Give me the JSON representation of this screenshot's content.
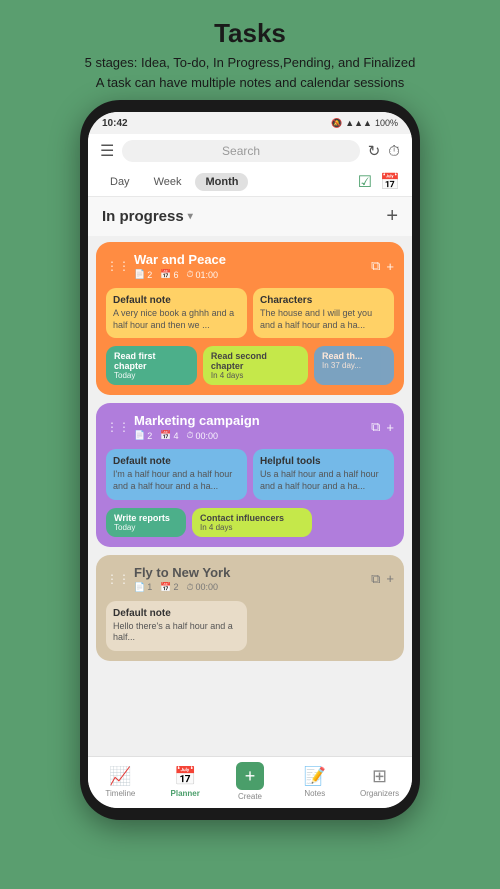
{
  "header": {
    "title": "Tasks",
    "subtitle_line1": "5 stages: Idea, To-do, In Progress,Pending, and Finalized",
    "subtitle_line2": "A task can have multiple notes and calendar sessions"
  },
  "status_bar": {
    "time": "10:42",
    "right_icons": "🔔 📶 🔋 100%"
  },
  "top_bar": {
    "search_placeholder": "Search",
    "refresh_icon": "↻",
    "timer_icon": "⏱"
  },
  "tabs": {
    "items": [
      "Day",
      "Week",
      "Month"
    ],
    "active": "Month"
  },
  "section": {
    "title": "In progress",
    "dropdown": "▾"
  },
  "tasks": [
    {
      "id": "war-peace",
      "title": "War and Peace",
      "meta": [
        {
          "icon": "📄",
          "value": "2"
        },
        {
          "icon": "📅",
          "value": "6"
        },
        {
          "icon": "⏱",
          "value": "01:00"
        }
      ],
      "color": "orange",
      "notes": [
        {
          "title": "Default note",
          "body": "A very nice book a ghhh and a half hour and then we ...",
          "color": "yellow"
        },
        {
          "title": "Characters",
          "body": "The house and I will get you and a half hour and a ha...",
          "color": "yellow"
        }
      ],
      "sessions": [
        {
          "label": "Read first chapter",
          "sub": "Today",
          "color": "green"
        },
        {
          "label": "Read second chapter",
          "sub": "In 4 days",
          "color": "lime"
        },
        {
          "label": "Read th...",
          "sub": "In 37 day...",
          "color": "blue",
          "partial": true
        }
      ]
    },
    {
      "id": "marketing",
      "title": "Marketing campaign",
      "meta": [
        {
          "icon": "📄",
          "value": "2"
        },
        {
          "icon": "📅",
          "value": "4"
        },
        {
          "icon": "⏱",
          "value": "00:00"
        }
      ],
      "color": "purple",
      "notes": [
        {
          "title": "Default note",
          "body": "I'm a half hour and a half hour and a half hour and a ha...",
          "color": "light-blue"
        },
        {
          "title": "Helpful tools",
          "body": "Us a half hour and a half hour and a half hour and a ha...",
          "color": "light-blue"
        }
      ],
      "sessions": [
        {
          "label": "Write reports",
          "sub": "Today",
          "color": "green"
        },
        {
          "label": "Contact influencers",
          "sub": "In 4 days",
          "color": "lime"
        }
      ]
    },
    {
      "id": "fly-new-york",
      "title": "Fly to New York",
      "meta": [
        {
          "icon": "📄",
          "value": "1"
        },
        {
          "icon": "📅",
          "value": "2"
        },
        {
          "icon": "⏱",
          "value": "00:00"
        }
      ],
      "color": "beige",
      "notes": [
        {
          "title": "Default note",
          "body": "Hello there's a half hour and a half...",
          "color": "beige-note"
        }
      ],
      "sessions": []
    }
  ],
  "bottom_nav": {
    "items": [
      {
        "label": "Timeline",
        "icon": "📈",
        "active": false
      },
      {
        "label": "Planner",
        "icon": "📅",
        "active": true
      },
      {
        "label": "Create",
        "icon": "+",
        "active": false,
        "special": true
      },
      {
        "label": "Notes",
        "icon": "📝",
        "active": false
      },
      {
        "label": "Organizers",
        "icon": "⊞",
        "active": false
      }
    ]
  }
}
